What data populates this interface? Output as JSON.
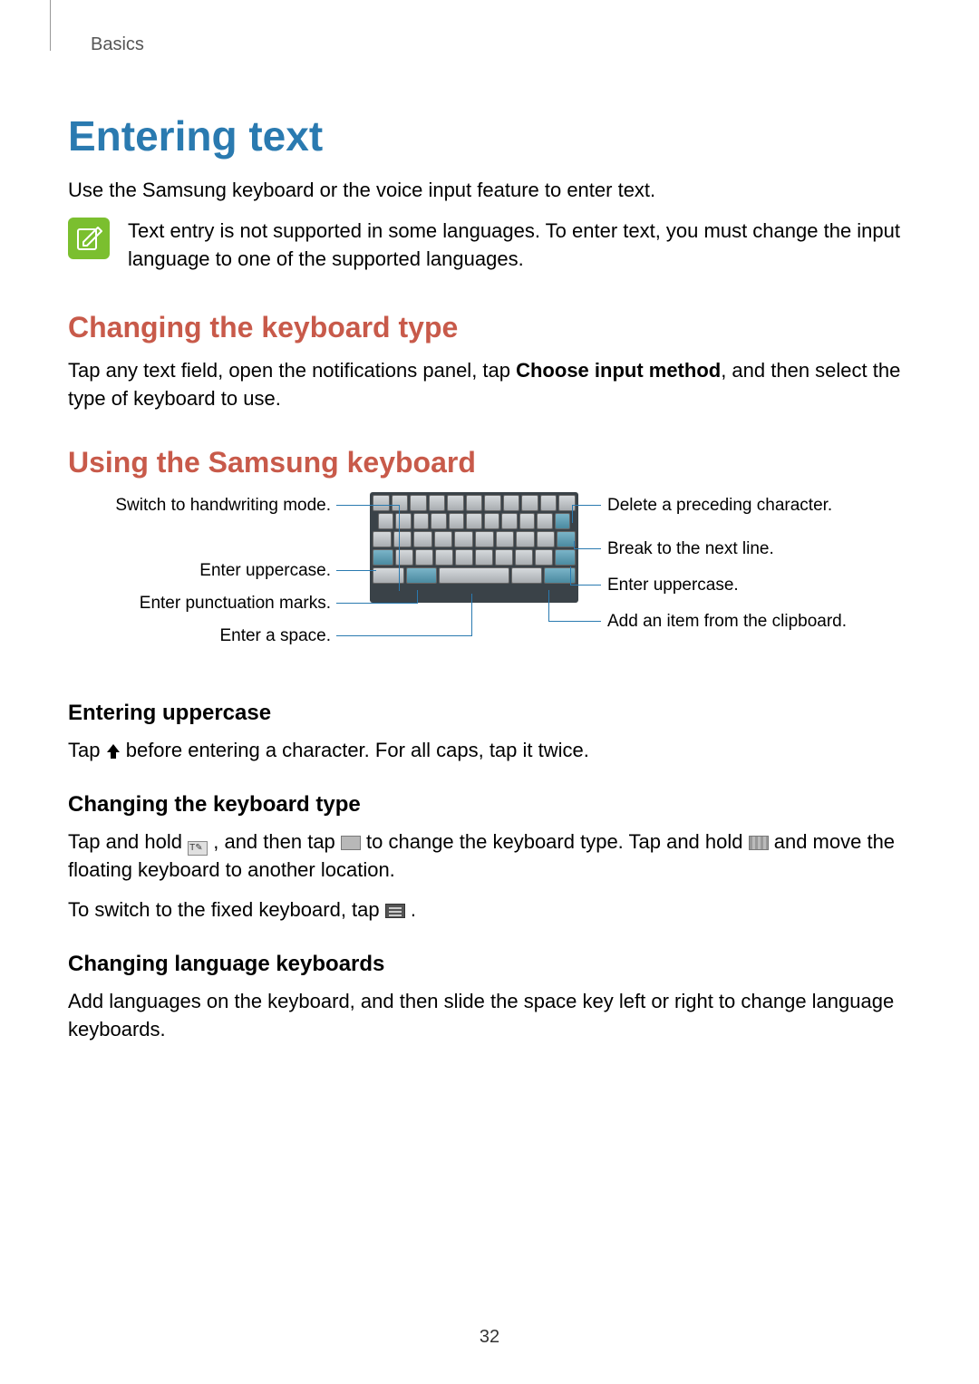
{
  "chapter": "Basics",
  "title": "Entering text",
  "intro": "Use the Samsung keyboard or the voice input feature to enter text.",
  "note": "Text entry is not supported in some languages. To enter text, you must change the input language to one of the supported languages.",
  "section1": {
    "heading": "Changing the keyboard type",
    "text_a": "Tap any text field, open the notifications panel, tap ",
    "bold": "Choose input method",
    "text_b": ", and then select the type of keyboard to use."
  },
  "section2": {
    "heading": "Using the Samsung keyboard",
    "callouts_left": [
      "Switch to handwriting mode.",
      "Enter uppercase.",
      "Enter punctuation marks.",
      "Enter a space."
    ],
    "callouts_right": [
      "Delete a preceding character.",
      "Break to the next line.",
      "Enter uppercase.",
      "Add an item from the clipboard."
    ]
  },
  "sub1": {
    "heading": "Entering uppercase",
    "text_a": "Tap ",
    "text_b": " before entering a character. For all caps, tap it twice."
  },
  "sub2": {
    "heading": "Changing the keyboard type",
    "p1_a": "Tap and hold ",
    "p1_b": ", and then tap ",
    "p1_c": " to change the keyboard type. Tap and hold ",
    "p1_d": " and move the floating keyboard to another location.",
    "p2_a": "To switch to the fixed keyboard, tap ",
    "p2_b": "."
  },
  "sub3": {
    "heading": "Changing language keyboards",
    "text": "Add languages on the keyboard, and then slide the space key left or right to change language keyboards."
  },
  "page_number": "32"
}
